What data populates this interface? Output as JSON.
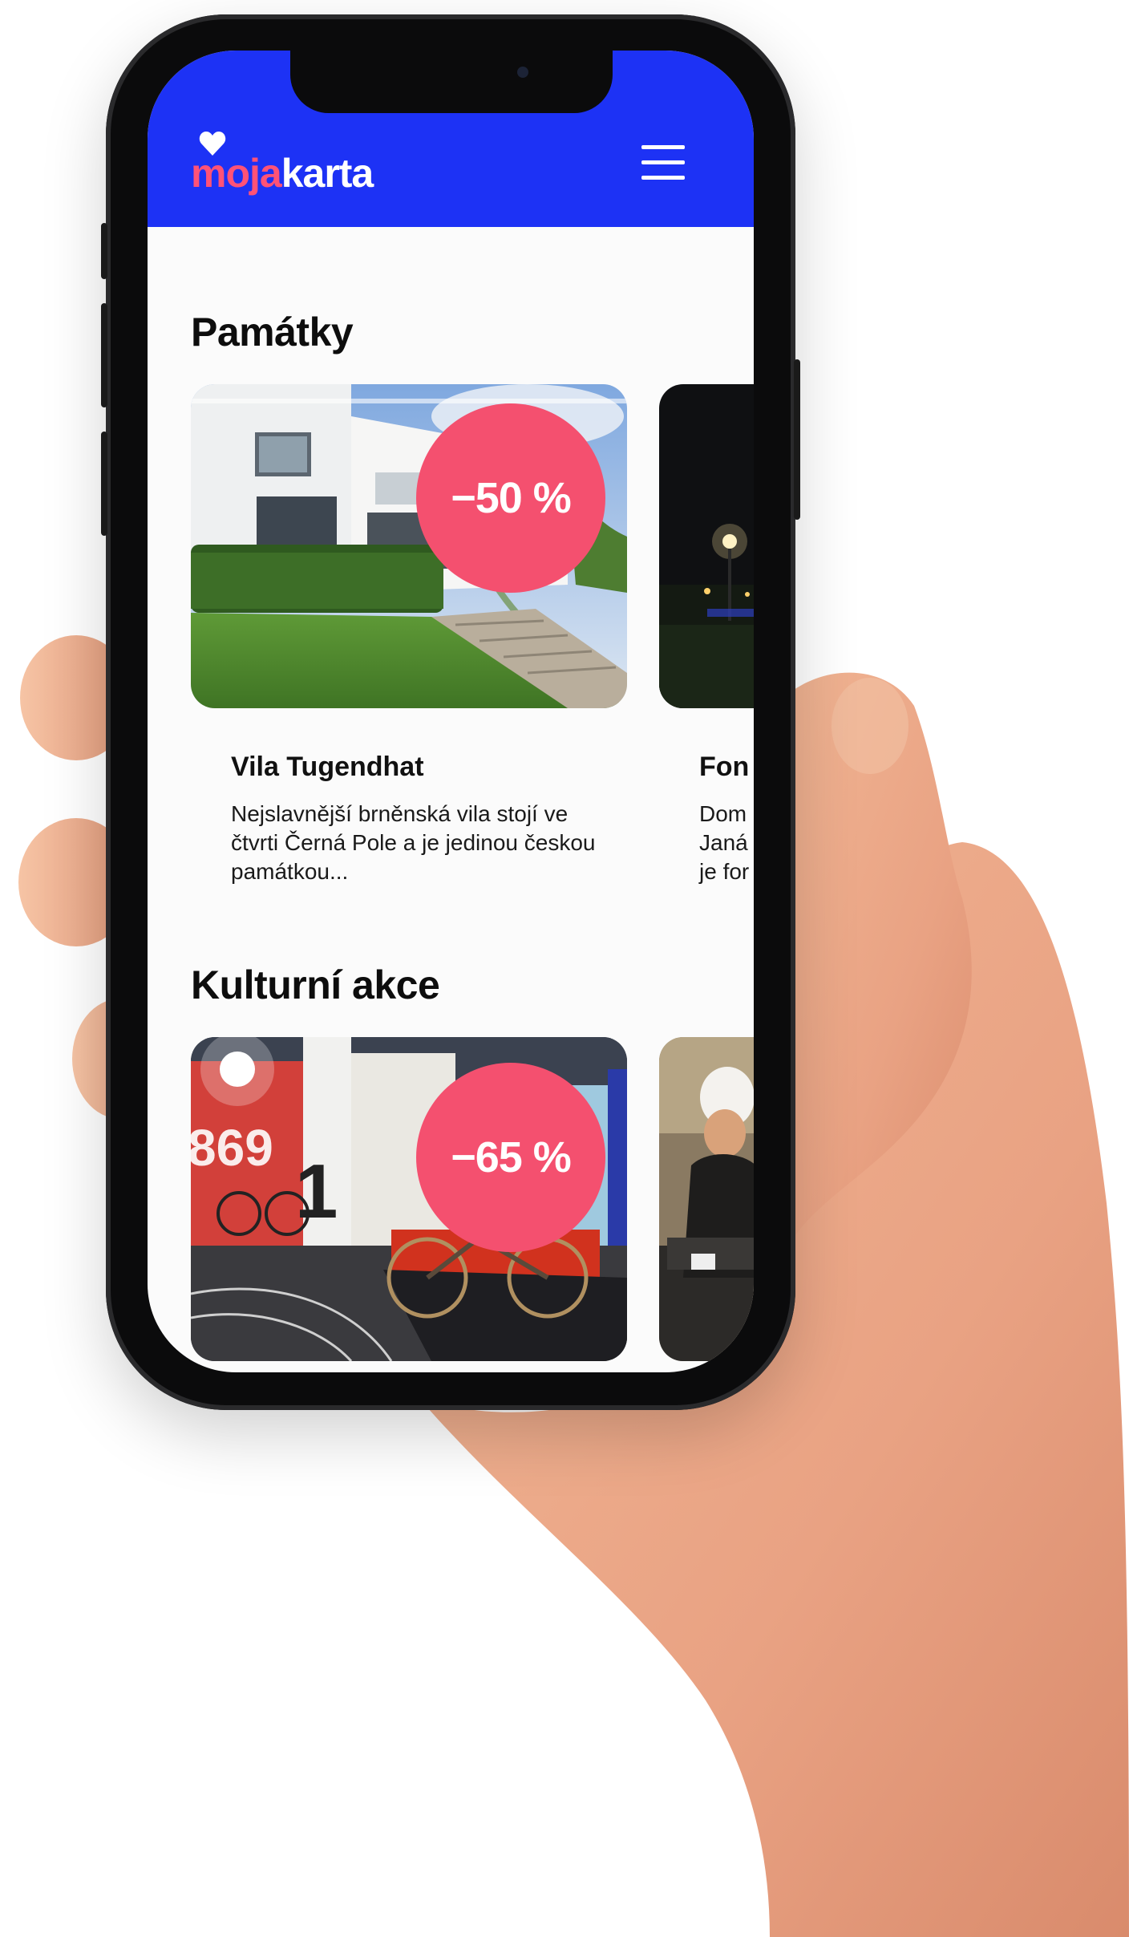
{
  "app": {
    "logo_part1": "moja",
    "logo_part2": "karta",
    "menu_icon": "hamburger-menu-icon"
  },
  "sections": [
    {
      "title": "Památky",
      "cards": [
        {
          "discount": "−50 %",
          "title": "Vila Tugendhat",
          "description": "Nejslavnější brněnská vila stojí ve čtvrti Černá Pole a je jedinou českou památkou..."
        },
        {
          "title": "Fon",
          "description_lines": [
            "Dom",
            "Janá",
            "je for"
          ]
        }
      ]
    },
    {
      "title": "Kulturní akce",
      "cards": [
        {
          "discount": "−65 %"
        },
        {}
      ]
    }
  ],
  "colors": {
    "header_blue": "#1d32f5",
    "brand_pink": "#ff5277",
    "badge_pink": "#f4506f"
  }
}
